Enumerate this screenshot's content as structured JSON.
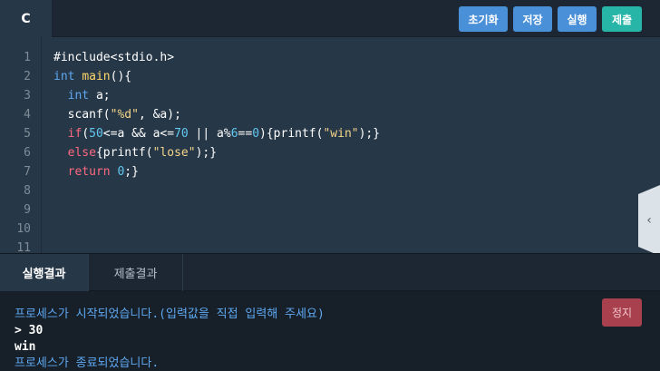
{
  "editor": {
    "language_tab": "C",
    "buttons": {
      "reset": "초기화",
      "save": "저장",
      "run": "실행",
      "submit": "제출"
    },
    "line_numbers": [
      "1",
      "2",
      "3",
      "4",
      "5",
      "6",
      "7",
      "8",
      "9",
      "10",
      "11"
    ],
    "code": {
      "l1": "#include<stdio.h>",
      "l2_type": "int",
      "l2_fn": "main",
      "l2_rest": "(){",
      "l3_type": "int",
      "l3_rest": " a;",
      "l4_fn": "scanf",
      "l4_open": "(",
      "l4_str": "\"%d\"",
      "l4_rest": ", &a);",
      "l5_kw": "if",
      "l5_open": "(",
      "l5_n1": "50",
      "l5_mid1": "<=a && a<=",
      "l5_n2": "70",
      "l5_mid2": " || a%",
      "l5_n3": "6",
      "l5_mid3": "==",
      "l5_n4": "0",
      "l5_mid4": "){",
      "l5_fn": "printf",
      "l5_open2": "(",
      "l5_str": "\"win\"",
      "l5_end": ");}",
      "l6_kw": "else",
      "l6_mid": "{",
      "l6_fn": "printf",
      "l6_open": "(",
      "l6_str": "\"lose\"",
      "l6_end": ");}",
      "l7_kw": "return",
      "l7_sp": " ",
      "l7_num": "0",
      "l7_end": ";}"
    }
  },
  "bottom": {
    "tabs": [
      "실행결과",
      "제출결과"
    ],
    "stop_label": "정지",
    "output": [
      "프로세스가 시작되었습니다.(입력값을 직접 입력해 주세요)",
      "> 30",
      "win",
      "프로세스가 종료되었습니다."
    ]
  },
  "icons": {
    "side_toggle": "chevron-left-icon"
  },
  "colors": {
    "accent_blue": "#4a90d9",
    "accent_green": "#27b5a8",
    "stop_red": "#a9404d"
  }
}
